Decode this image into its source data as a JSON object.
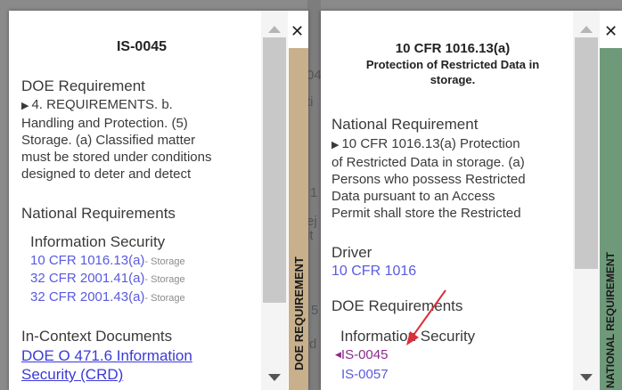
{
  "left_panel": {
    "title": "IS-0045",
    "req_heading": "DOE Requirement",
    "req_lines": [
      "4. REQUIREMENTS. b.",
      "Handling and Protection. (5)",
      "Storage. (a) Classified matter",
      "must be stored under conditions",
      "designed to deter and detect"
    ],
    "national_heading": "National Requirements",
    "category": "Information Security",
    "links": [
      {
        "code": "10 CFR 1016.13(a)",
        "note": "- Storage"
      },
      {
        "code": "32 CFR 2001.41(a)",
        "note": "- Storage"
      },
      {
        "code": "32 CFR 2001.43(a)",
        "note": "- Storage"
      }
    ],
    "context_heading": "In-Context Documents",
    "context_link_line1": "DOE O 471.6 Information",
    "context_link_line2": "Security (CRD)",
    "close_symbol": "✕",
    "tab_label": "DOE REQUIREMENT",
    "tab_color": "#c8b08c"
  },
  "right_panel": {
    "title": "10 CFR 1016.13(a)",
    "subtitle_line1": "Protection of Restricted Data in",
    "subtitle_line2": "storage.",
    "req_heading": "National Requirement",
    "req_lines": [
      "10 CFR 1016.13(a)   Protection",
      "of Restricted Data in storage. (a)",
      "Persons who possess Restricted",
      "Data pursuant to an Access",
      "Permit shall store the Restricted"
    ],
    "driver_heading": "Driver",
    "driver_link": "10 CFR 1016",
    "doe_heading": "DOE Requirements",
    "category": "Information Security",
    "doe_links": [
      "IS-0045",
      "IS-0057"
    ],
    "close_symbol": "✕",
    "tab_label": "NATIONAL REQUIREMENT",
    "tab_color": "#6e9a7a"
  },
  "background": {
    "frag1": "04",
    "frag2": "ti",
    "frag3": "1",
    "frag4": "ej",
    "frag5": "it",
    "frag6": "5",
    "frag7": "d"
  }
}
